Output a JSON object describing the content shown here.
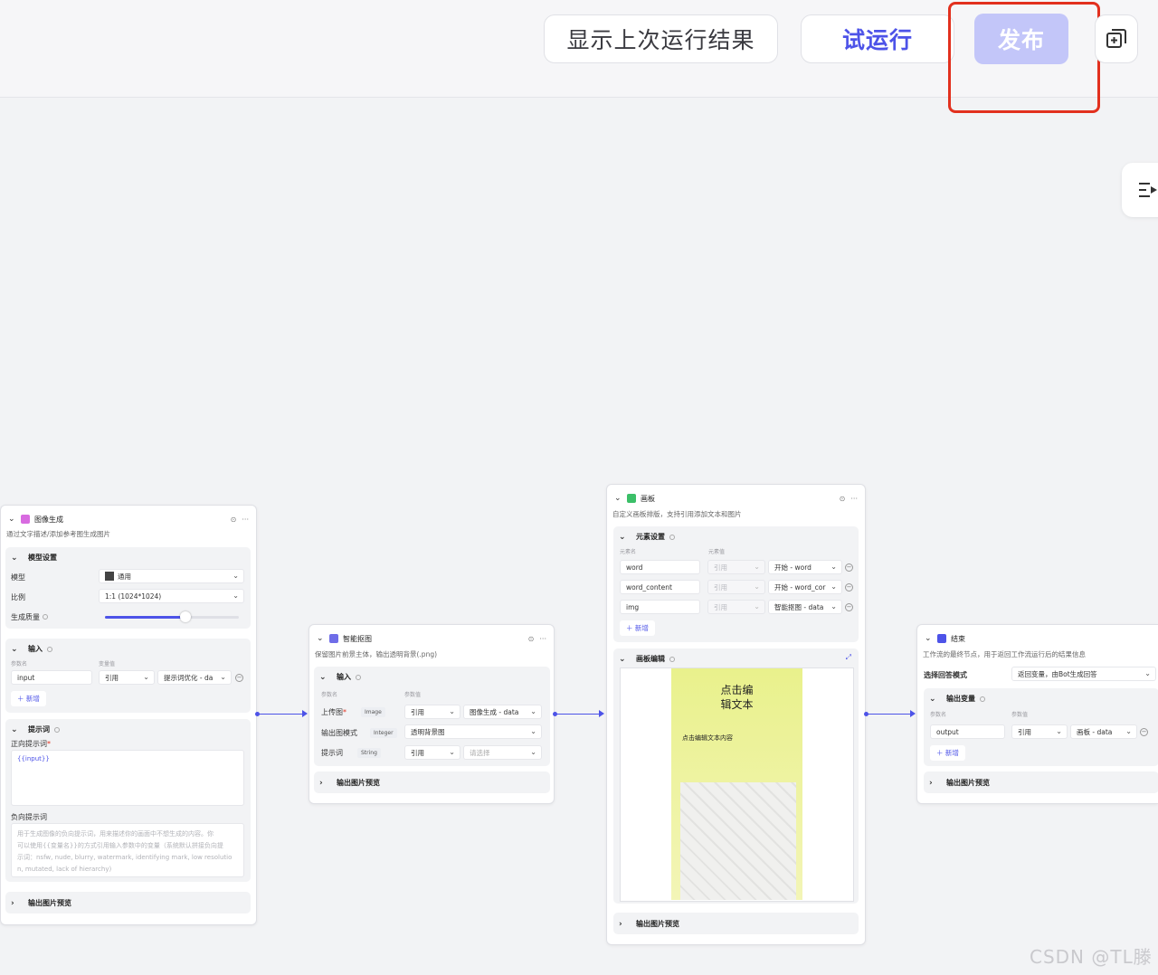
{
  "toolbar": {
    "show_last_result": "显示上次运行结果",
    "test_run": "试运行",
    "publish": "发布"
  },
  "nodes": {
    "image_gen": {
      "title": "图像生成",
      "desc": "通过文字描述/添加参考图生成图片",
      "model_settings": "模型设置",
      "model_label": "模型",
      "model_value": "通用",
      "ratio_label": "比例",
      "ratio_value": "1:1 (1024*1024)",
      "quality_label": "生成质量",
      "input_title": "输入",
      "param_name": "参数名",
      "param_value": "变量值",
      "input_name": "input",
      "input_ref": "引用",
      "input_var": "提示词优化 - da",
      "add": "新增",
      "prompt_title": "提示词",
      "positive_label": "正向提示词",
      "positive_value": "{{input}}",
      "negative_label": "负向提示词",
      "negative_placeholder_1": "用于生成图像的负向提示词，用来描述你的画面中不想生成的内容。你",
      "negative_placeholder_2": "可以使用{{变量名}}的方式引用输入参数中的变量（系统默认拼接负向提",
      "negative_placeholder_3": "示词：nsfw, nude, blurry, watermark, identifying mark, low resolutio",
      "negative_placeholder_4": "n, mutated, lack of hierarchy)",
      "output_preview": "输出图片预览"
    },
    "matting": {
      "title": "智能抠图",
      "desc": "保留图片前景主体，输出透明背景(.png)",
      "input_title": "输入",
      "param_name": "参数名",
      "param_value": "参数值",
      "row1_label": "上传图",
      "row1_type": "Image",
      "row1_ref": "引用",
      "row1_var": "图像生成 - data",
      "row2_label": "输出图模式",
      "row2_type": "Integer",
      "row2_value": "透明背景图",
      "row3_label": "提示词",
      "row3_type": "String",
      "row3_ref": "引用",
      "row3_var": "请选择",
      "output_preview": "输出图片预览"
    },
    "canvas": {
      "title": "画板",
      "desc": "自定义画板排版，支持引用添加文本和图片",
      "elements_title": "元素设置",
      "elem_name": "元素名",
      "elem_value": "元素值",
      "rows": [
        {
          "name": "word",
          "ref": "引用",
          "var": "开始 - word"
        },
        {
          "name": "word_content",
          "ref": "引用",
          "var": "开始 - word_cor"
        },
        {
          "name": "img",
          "ref": "引用",
          "var": "智能抠图 - data"
        }
      ],
      "add": "新增",
      "edit_title": "画板编辑",
      "poster_title_1": "点击编",
      "poster_title_2": "辑文本",
      "poster_sub": "点击编辑文本内容",
      "output_preview": "输出图片预览"
    },
    "end": {
      "title": "结束",
      "desc": "工作流的最终节点，用于返回工作流运行后的结果信息",
      "mode_label": "选择回答模式",
      "mode_value": "返回变量，由Bot生成回答",
      "output_title": "输出变量",
      "param_name": "参数名",
      "param_value": "参数值",
      "output_name": "output",
      "output_ref": "引用",
      "output_var": "画板 - data",
      "add": "新增",
      "output_preview": "输出图片预览"
    }
  },
  "watermark": "CSDN @TL滕",
  "colors": {
    "accent": "#4d53e8",
    "publish_bg": "#c3c6f9",
    "highlight": "#e2301e"
  }
}
